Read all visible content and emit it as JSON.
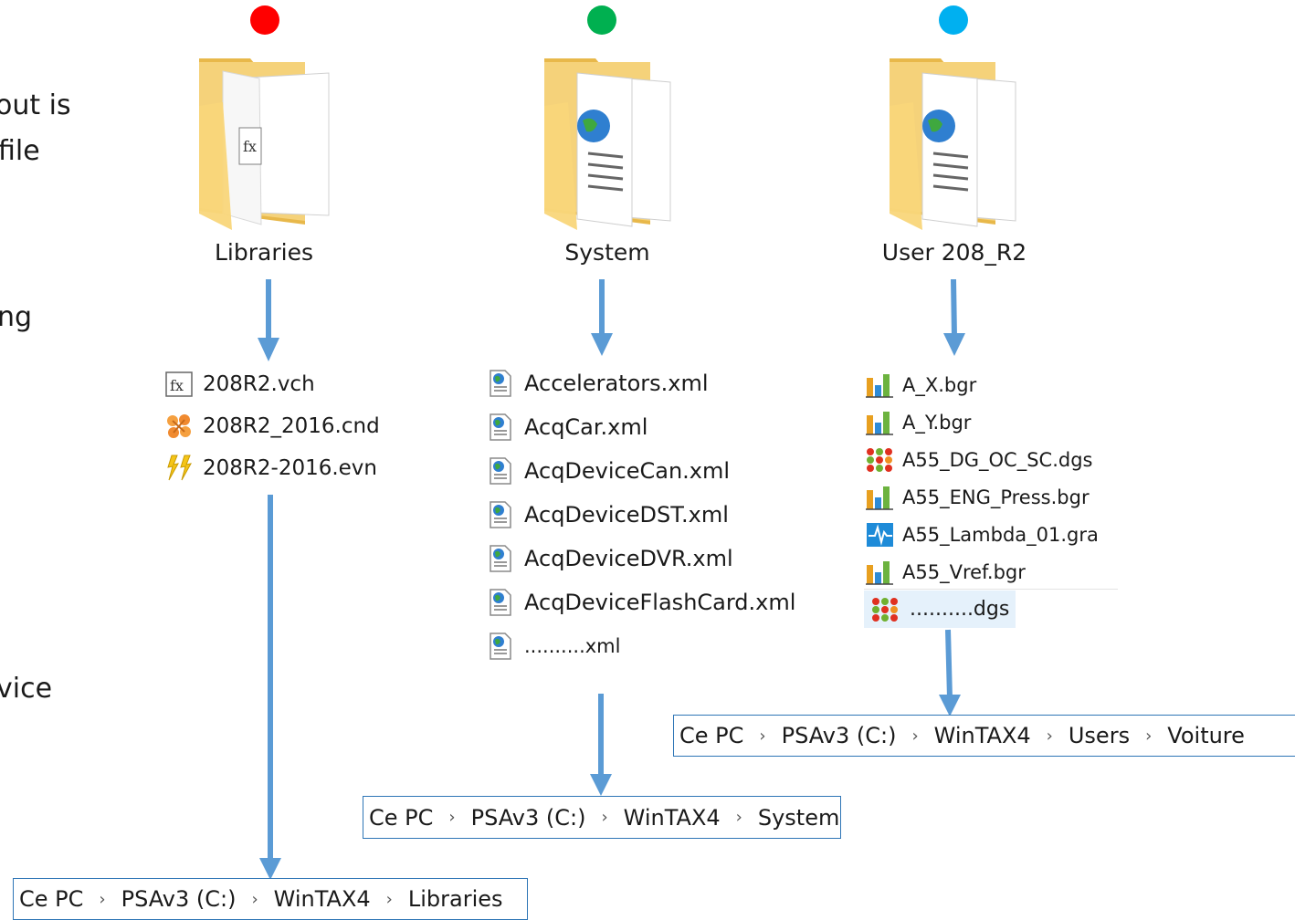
{
  "side_text": [
    "out is",
    "file",
    "ng",
    "vice"
  ],
  "colors": {
    "red": "#ff0000",
    "green": "#00b050",
    "blue": "#00b0f0",
    "arrow": "#5b9bd5",
    "breadcrumb_border": "#2e75b6"
  },
  "folders": [
    {
      "label": "Libraries",
      "icon": "folder-fx-icon"
    },
    {
      "label": "System",
      "icon": "folder-xml-icon"
    },
    {
      "label": "User 208_R2",
      "icon": "folder-xml-icon"
    }
  ],
  "libraries_files": [
    {
      "name": "208R2.vch",
      "icon": "fx-file-icon"
    },
    {
      "name": "208R2_2016.cnd",
      "icon": "condition-file-icon"
    },
    {
      "name": "208R2-2016.evn",
      "icon": "event-file-icon"
    }
  ],
  "system_files": [
    {
      "name": "Accelerators.xml",
      "icon": "xml-file-icon"
    },
    {
      "name": "AcqCar.xml",
      "icon": "xml-file-icon"
    },
    {
      "name": "AcqDeviceCan.xml",
      "icon": "xml-file-icon"
    },
    {
      "name": "AcqDeviceDST.xml",
      "icon": "xml-file-icon"
    },
    {
      "name": "AcqDeviceDVR.xml",
      "icon": "xml-file-icon"
    },
    {
      "name": "AcqDeviceFlashCard.xml",
      "icon": "xml-file-icon"
    },
    {
      "name": "..........xml",
      "icon": "xml-file-icon"
    }
  ],
  "user_files": [
    {
      "name": "A_X.bgr",
      "icon": "bargraph-file-icon"
    },
    {
      "name": "A_Y.bgr",
      "icon": "bargraph-file-icon"
    },
    {
      "name": "A55_DG_OC_SC.dgs",
      "icon": "dgs-file-icon"
    },
    {
      "name": "A55_ENG_Press.bgr",
      "icon": "bargraph-file-icon"
    },
    {
      "name": "A55_Lambda_01.gra",
      "icon": "graph-file-icon"
    },
    {
      "name": "A55_Vref.bgr",
      "icon": "bargraph-file-icon"
    },
    {
      "name": "..........dgs",
      "icon": "dgs-file-icon"
    }
  ],
  "breadcrumbs": {
    "libraries": [
      "Ce PC",
      "PSAv3 (C:)",
      "WinTAX4",
      "Libraries"
    ],
    "system": [
      "Ce PC",
      "PSAv3 (C:)",
      "WinTAX4",
      "System"
    ],
    "user": [
      "Ce PC",
      "PSAv3 (C:)",
      "WinTAX4",
      "Users",
      "Voiture"
    ]
  },
  "separator": "›"
}
